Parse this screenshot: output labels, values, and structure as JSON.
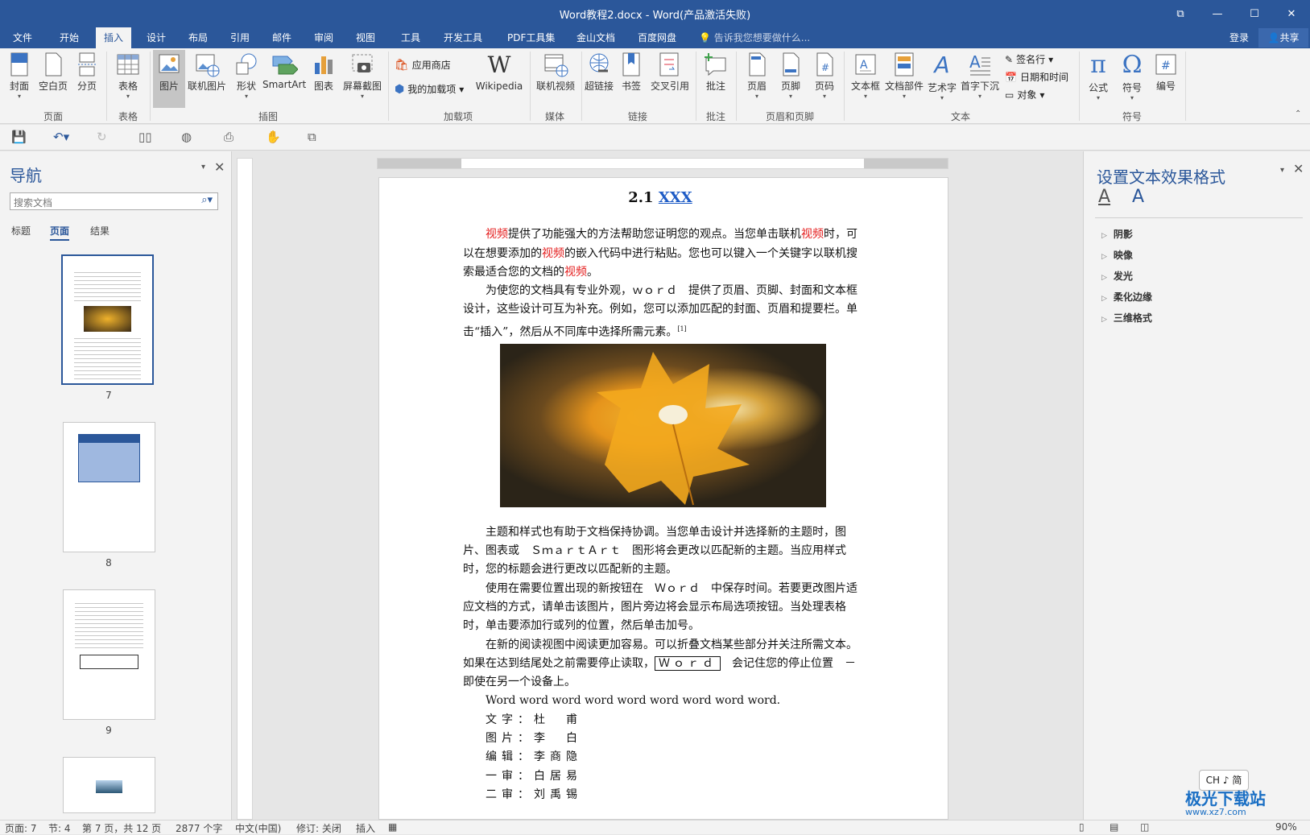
{
  "window": {
    "title": "Word教程2.docx - Word(产品激活失败)",
    "buttons": [
      "⧉",
      "—",
      "☐",
      "✕"
    ]
  },
  "tabs": [
    "文件",
    "开始",
    "插入",
    "设计",
    "布局",
    "引用",
    "邮件",
    "审阅",
    "视图",
    "工具",
    "开发工具",
    "PDF工具集",
    "金山文档",
    "百度网盘"
  ],
  "active_tab": "插入",
  "tell_me": "告诉我您想要做什么...",
  "login": "登录",
  "share": "共享",
  "ribbon": {
    "page": {
      "cover": "封面",
      "blank": "空白页",
      "break": "分页",
      "group": "页面"
    },
    "table": {
      "table": "表格",
      "group": "表格"
    },
    "illustrations": {
      "picture": "图片",
      "online_picture": "联机图片",
      "shapes": "形状",
      "smartart": "SmartArt",
      "chart": "图表",
      "screenshot": "屏幕截图",
      "group": "插图"
    },
    "addins": {
      "store": "应用商店",
      "my_addins": "我的加载项",
      "wikipedia": "Wikipedia",
      "group": "加载项"
    },
    "media": {
      "online_video": "联机视频",
      "group": "媒体"
    },
    "links": {
      "hyperlink": "超链接",
      "bookmark": "书签",
      "cross_ref": "交叉引用",
      "group": "链接"
    },
    "comments": {
      "comment": "批注",
      "group": "批注"
    },
    "header_footer": {
      "header": "页眉",
      "footer": "页脚",
      "page_number": "页码",
      "group": "页眉和页脚"
    },
    "text": {
      "textbox": "文本框",
      "quickparts": "文档部件",
      "wordart": "艺术字",
      "dropcap": "首字下沉",
      "signature": "签名行",
      "datetime": "日期和时间",
      "object": "对象",
      "group": "文本"
    },
    "symbols": {
      "equation": "公式",
      "symbol": "符号",
      "number": "编号",
      "group": "符号"
    }
  },
  "nav": {
    "title": "导航",
    "search_placeholder": "搜索文档",
    "tabs": [
      "标题",
      "页面",
      "结果"
    ],
    "pages": [
      "7",
      "8",
      "9"
    ]
  },
  "doc": {
    "heading_num": "2.1",
    "heading_link": "XXX",
    "p1": [
      {
        "t": "视频",
        "red": true
      },
      {
        "t": "提供了功能强大的方法帮助您证明您的观点。当您单击联机"
      },
      {
        "t": "视频",
        "red": true
      },
      {
        "t": "时，可以在想要添加的"
      },
      {
        "t": "视频",
        "red": true
      },
      {
        "t": "的嵌入代码中进行粘贴。您也可以键入一个关键字以联机搜索最适合您的文档的"
      },
      {
        "t": "视频",
        "red": true
      },
      {
        "t": "。"
      }
    ],
    "p2": "为使您的文档具有专业外观，ｗｏｒｄ　提供了页眉、页脚、封面和文本框设计，这些设计可互为补充。例如，您可以添加匹配的封面、页眉和提要栏。单击“插入”，然后从不同库中选择所需元素。",
    "p2_note": "[1]",
    "p3": "主题和样式也有助于文档保持协调。当您单击设计并选择新的主题时，图片、图表或　ＳｍａｒｔＡｒｔ　图形将会更改以匹配新的主题。当应用样式时，您的标题会进行更改以匹配新的主题。",
    "p4": "使用在需要位置出现的新按钮在　Ｗｏｒｄ　中保存时间。若要更改图片适应文档的方式，请单击该图片，图片旁边将会显示布局选项按钮。当处理表格时，单击要添加行或列的位置，然后单击加号。",
    "p5a": "在新的阅读视图中阅读更加容易。可以折叠文档某些部分并关注所需文本。如果在达到结尾处之前需要停止读取，",
    "p5_box": "Ｗｏｒｄ",
    "p5b": "　会记住您的停止位置　－　即使在另一个设备上。",
    "p6": "Word word word word word word word word word.",
    "credits": [
      "文字：杜　甫",
      "图片：李　白",
      "编辑：李商隐",
      "一审：白居易",
      "二审：刘禹锡"
    ]
  },
  "panel": {
    "title": "设置文本效果格式",
    "sections": [
      "阴影",
      "映像",
      "发光",
      "柔化边缘",
      "三维格式"
    ]
  },
  "status": {
    "page": "页面: 7",
    "section": "节: 4",
    "pageof": "第 7 页，共 12 页",
    "words": "2877 个字",
    "lang": "中文(中国)",
    "track": "修订: 关闭",
    "mode": "插入",
    "zoom": "90%"
  },
  "ime": "CH ♪ 简",
  "watermark": {
    "name": "极光下载站",
    "url": "www.xz7.com"
  }
}
